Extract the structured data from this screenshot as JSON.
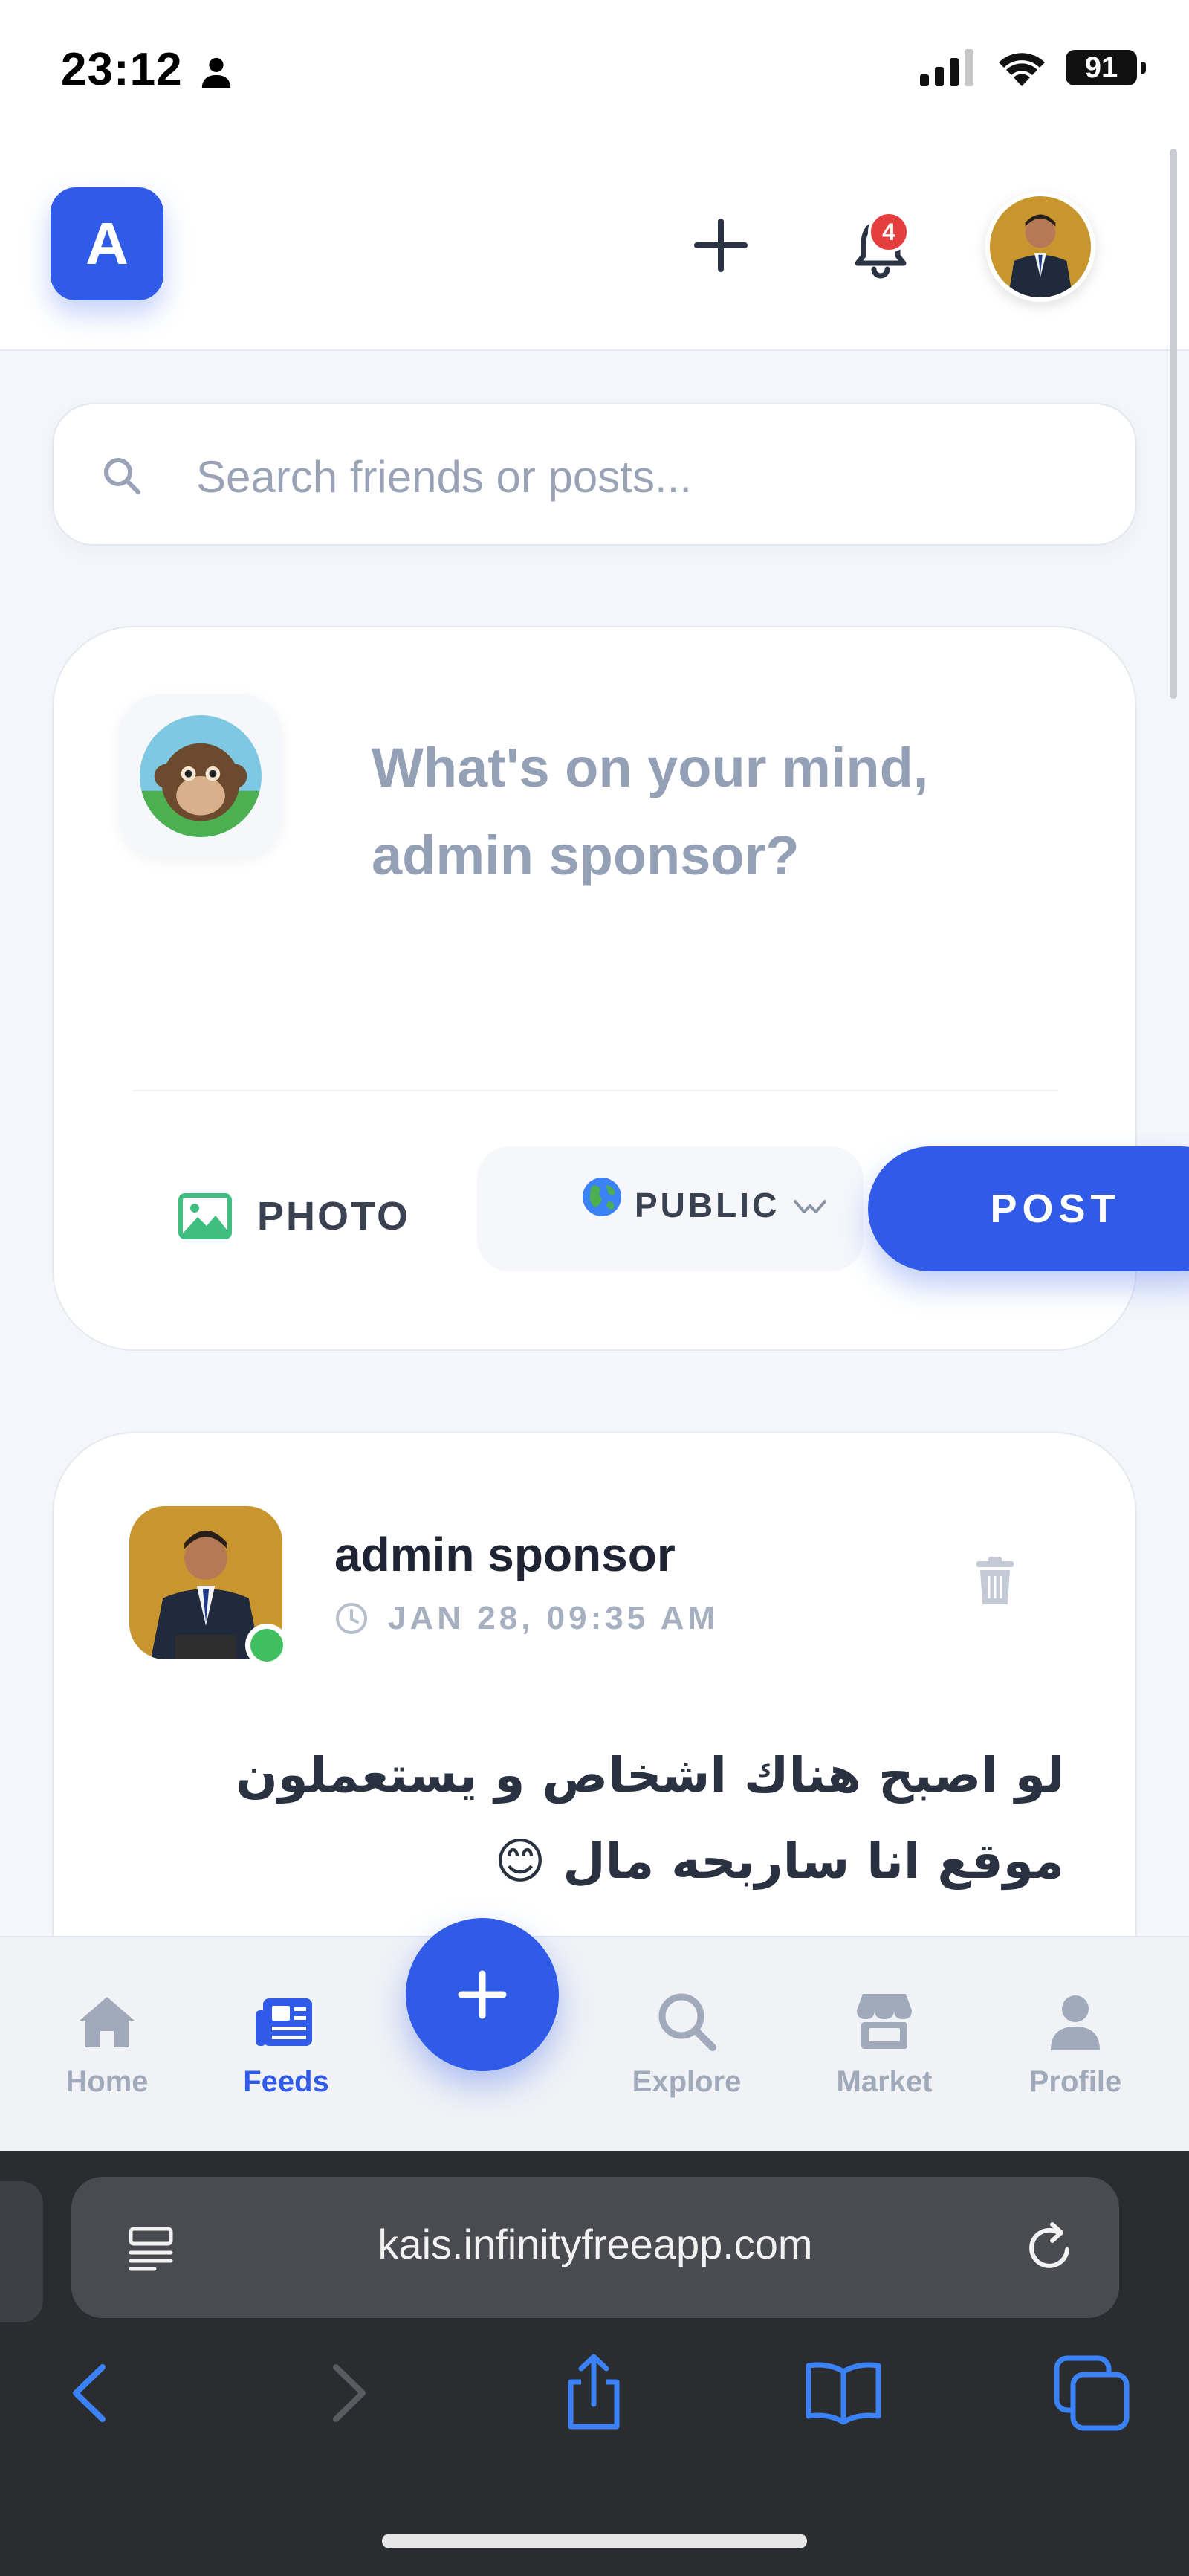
{
  "status_bar": {
    "time": "23:12",
    "battery": "91"
  },
  "header": {
    "logo_letter": "A",
    "notification_count": "4"
  },
  "search": {
    "placeholder": "Search friends or posts..."
  },
  "composer": {
    "prompt": "What's on your mind, admin sponsor?",
    "photo_label": "PHOTO",
    "privacy_label": "PUBLIC",
    "post_label": "POST"
  },
  "post": {
    "author": "admin sponsor",
    "timestamp": "JAN 28, 09:35 AM",
    "text": "لو اصبح هناك اشخاص و يستعملون موقع انا ساربحه مال 😊",
    "online": true
  },
  "bottom_nav": {
    "items": [
      {
        "label": "Home",
        "icon": "home-icon",
        "active": false
      },
      {
        "label": "Feeds",
        "icon": "newspaper-icon",
        "active": true
      },
      {
        "label": "Explore",
        "icon": "search-icon",
        "active": false
      },
      {
        "label": "Market",
        "icon": "store-icon",
        "active": false
      },
      {
        "label": "Profile",
        "icon": "user-icon",
        "active": false
      }
    ]
  },
  "browser": {
    "url": "kais.infinityfreeapp.com"
  },
  "colors": {
    "accent": "#2f5be8",
    "online": "#3fbf5f",
    "badge": "#e53e3e",
    "muted": "#94a0b5"
  }
}
